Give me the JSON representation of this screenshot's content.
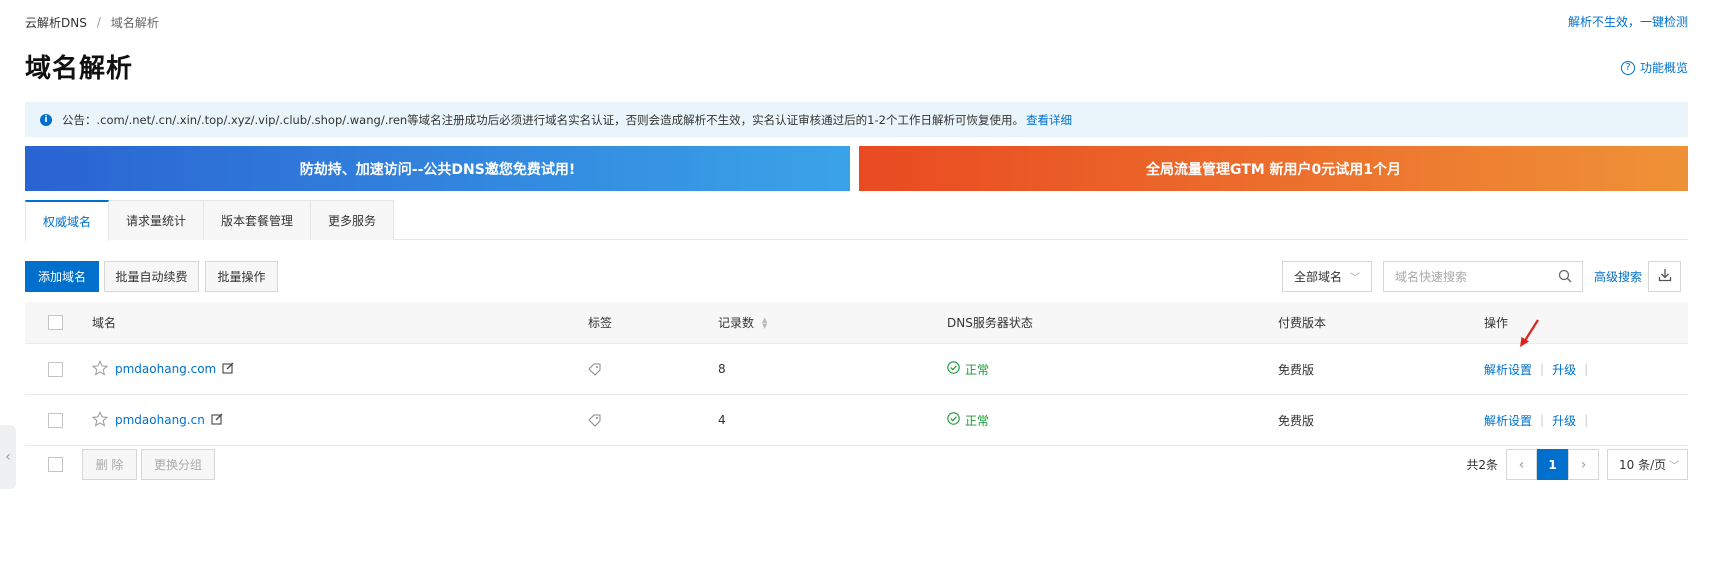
{
  "breadcrumb": {
    "root": "云解析DNS",
    "separator": "/",
    "current": "域名解析"
  },
  "top_link": "解析不生效，一键检测",
  "page_title": "域名解析",
  "overview_link": {
    "icon": "question-icon",
    "label": "功能概览"
  },
  "notice": {
    "icon": "info-icon",
    "text": "公告：.com/.net/.cn/.xin/.top/.xyz/.vip/.club/.shop/.wang/.ren等域名注册成功后必须进行域名实名认证，否则会造成解析不生效，实名认证审核通过后的1-2个工作日解析可恢复使用。",
    "link": "查看详细"
  },
  "banners": {
    "left": "防劫持、加速访问--公共DNS邀您免费试用!",
    "right": "全局流量管理GTM 新用户0元试用1个月",
    "colors": {
      "left_start": "#2a63d2",
      "left_end": "#3aa3e8",
      "right_start": "#e94a22",
      "right_end": "#ef9237"
    }
  },
  "tabs": [
    {
      "label": "权威域名",
      "active": true
    },
    {
      "label": "请求量统计",
      "active": false
    },
    {
      "label": "版本套餐管理",
      "active": false
    },
    {
      "label": "更多服务",
      "active": false
    }
  ],
  "toolbar": {
    "add_domain": "添加域名",
    "batch_renew": "批量自动续费",
    "batch_ops": "批量操作",
    "filter_select": "全部域名",
    "search_placeholder": "域名快速搜索",
    "advanced_search": "高级搜索"
  },
  "table": {
    "headers": {
      "domain": "域名",
      "tag": "标签",
      "records": "记录数",
      "dns_status": "DNS服务器状态",
      "plan": "付费版本",
      "ops": "操作"
    },
    "rows": [
      {
        "domain": "pmdaohang.com",
        "records": "8",
        "status": "正常",
        "plan": "免费版",
        "op1": "解析设置",
        "op2": "升级"
      },
      {
        "domain": "pmdaohang.cn",
        "records": "4",
        "status": "正常",
        "plan": "免费版",
        "op1": "解析设置",
        "op2": "升级"
      }
    ]
  },
  "footer": {
    "delete": "删 除",
    "change_group": "更换分组",
    "total": "共2条",
    "current_page": "1",
    "page_size": "10 条/页"
  },
  "colors": {
    "accent": "#0070cc",
    "ok": "#1a9b3a",
    "arrow": "#e0201b"
  }
}
